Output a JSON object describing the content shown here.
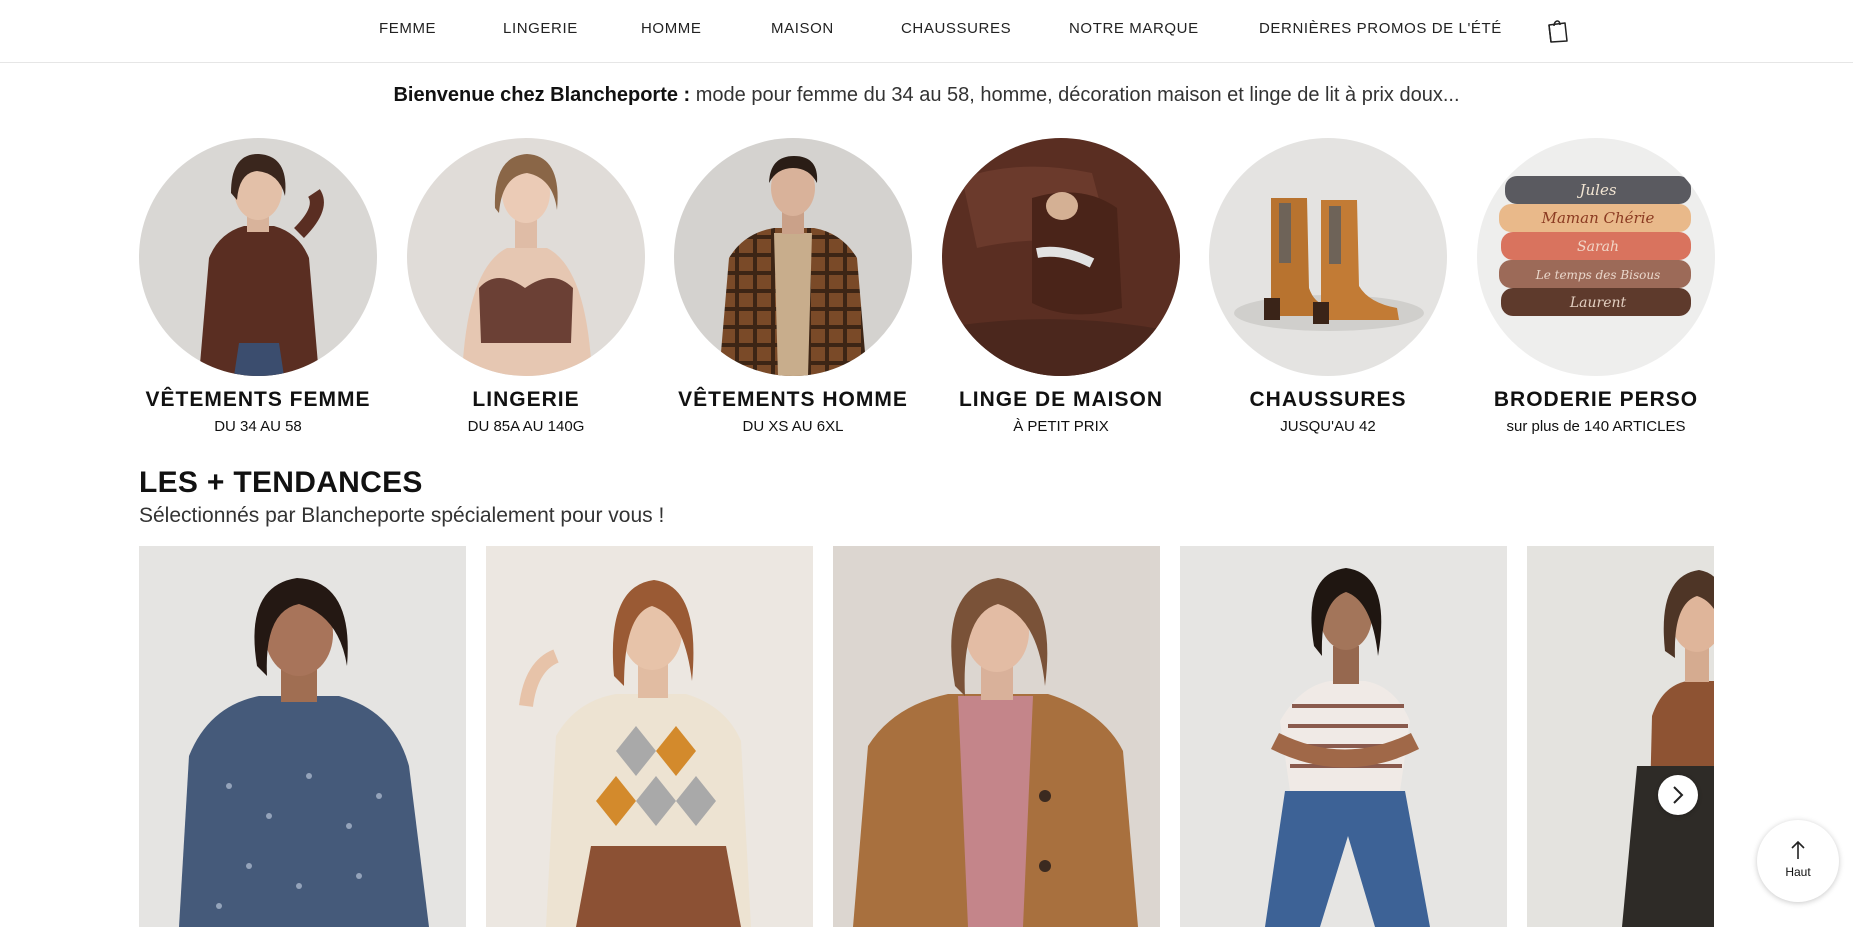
{
  "nav": {
    "items": [
      "FEMME",
      "LINGERIE",
      "HOMME",
      "MAISON",
      "CHAUSSURES",
      "NOTRE MARQUE",
      "DERNIÈRES PROMOS DE L'ÉTÉ"
    ],
    "bag_icon": "shopping-bag-icon"
  },
  "welcome": {
    "bold": "Bienvenue chez Blancheporte :",
    "text": " mode pour femme du 34 au 58, homme, décoration maison et linge de lit à prix doux..."
  },
  "categories": [
    {
      "title": "VÊTEMENTS FEMME",
      "sub": "DU 34 AU 58"
    },
    {
      "title": "LINGERIE",
      "sub": "DU 85A AU 140G"
    },
    {
      "title": "VÊTEMENTS HOMME",
      "sub": "DU XS AU 6XL"
    },
    {
      "title": "LINGE DE MAISON",
      "sub": "À PETIT PRIX"
    },
    {
      "title": "CHAUSSURES",
      "sub": "JUSQU'AU 42"
    },
    {
      "title": "BRODERIE PERSO",
      "sub": "sur plus de 140 ARTICLES"
    }
  ],
  "towels": [
    "Jules",
    "Maman Chérie",
    "Sarah",
    "Le temps des Bisous",
    "Laurent"
  ],
  "trends": {
    "title": "LES + TENDANCES",
    "subtitle": "Sélectionnés par Blancheporte spécialement pour vous !"
  },
  "colors": {
    "accent_brown": "#5a2e22",
    "text": "#111111",
    "nav_border": "#e6e6e6"
  },
  "back_to_top": {
    "label": "Haut",
    "icon": "arrow-up-icon"
  },
  "carousel": {
    "next_icon": "chevron-right-icon"
  }
}
